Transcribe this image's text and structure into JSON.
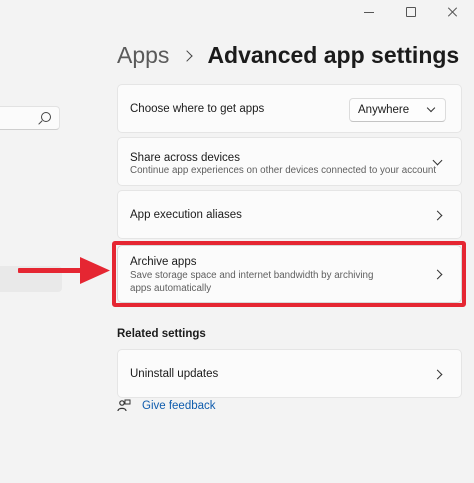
{
  "window": {
    "controls": [
      "minimize",
      "maximize",
      "close"
    ]
  },
  "breadcrumb": {
    "parent": "Apps",
    "current": "Advanced app settings"
  },
  "settings": {
    "get_apps": {
      "title": "Choose where to get apps",
      "dropdown_value": "Anywhere"
    },
    "share_devices": {
      "title": "Share across devices",
      "description": "Continue app experiences on other devices connected to your account"
    },
    "aliases": {
      "title": "App execution aliases"
    },
    "archive": {
      "title": "Archive apps",
      "description": "Save storage space and internet bandwidth by archiving apps automatically"
    }
  },
  "related": {
    "heading": "Related settings",
    "uninstall_updates": "Uninstall updates"
  },
  "feedback": {
    "label": "Give feedback"
  },
  "colors": {
    "highlight": "#e52632",
    "link": "#0f5cad",
    "background": "#f3f3f3",
    "card": "#fbfbfb"
  },
  "icons": {
    "search": "search-icon",
    "feedback": "feedback-icon",
    "chevron_right": "chevron-right-icon",
    "chevron_down": "chevron-down-icon"
  }
}
